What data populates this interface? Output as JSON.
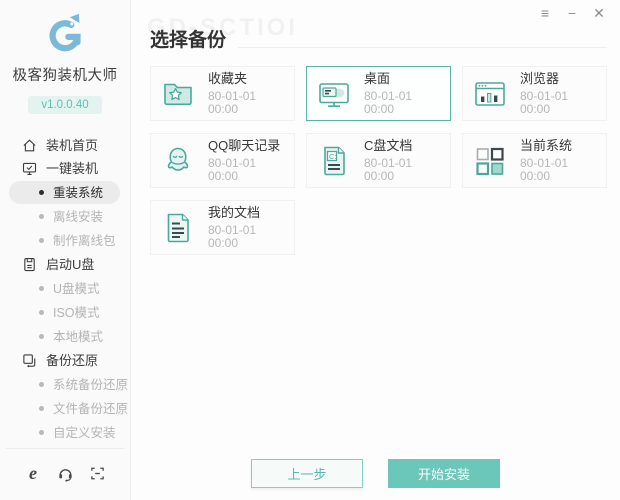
{
  "window": {
    "controls": {
      "menu": "≡",
      "minimize": "−",
      "close": "✕"
    }
  },
  "sidebar": {
    "app_name": "极客狗装机大师",
    "version": "v1.0.0.40",
    "menu": [
      {
        "label": "装机首页",
        "icon": "home-icon",
        "level": "top"
      },
      {
        "label": "一键装机",
        "icon": "monitor-icon",
        "level": "top"
      },
      {
        "label": "重装系统",
        "level": "sub",
        "active": true
      },
      {
        "label": "离线安装",
        "level": "sub",
        "active": false
      },
      {
        "label": "制作离线包",
        "level": "sub",
        "active": false
      },
      {
        "label": "启动U盘",
        "icon": "usb-disk-icon",
        "level": "top"
      },
      {
        "label": "U盘模式",
        "level": "sub",
        "active": false
      },
      {
        "label": "ISO模式",
        "level": "sub",
        "active": false
      },
      {
        "label": "本地模式",
        "level": "sub",
        "active": false
      },
      {
        "label": "备份还原",
        "icon": "backup-restore-icon",
        "level": "top"
      },
      {
        "label": "系统备份还原",
        "level": "sub",
        "active": false
      },
      {
        "label": "文件备份还原",
        "level": "sub",
        "active": false
      },
      {
        "label": "自定义安装",
        "level": "sub",
        "active": false
      }
    ],
    "footer_icons": [
      "browser-e-icon",
      "headset-icon",
      "scan-icon"
    ]
  },
  "main": {
    "title": "选择备份",
    "watermark": "GD-SCTIOI",
    "cards": [
      {
        "label": "收藏夹",
        "date": "80-01-01 00:00",
        "icon": "folder-star-icon",
        "selected": false
      },
      {
        "label": "桌面",
        "date": "80-01-01 00:00",
        "icon": "desktop-icon",
        "selected": true
      },
      {
        "label": "浏览器",
        "date": "80-01-01 00:00",
        "icon": "browser-icon",
        "selected": false
      },
      {
        "label": "QQ聊天记录",
        "date": "80-01-01 00:00",
        "icon": "qq-penguin-icon",
        "selected": false
      },
      {
        "label": "C盘文档",
        "date": "80-01-01 00:00",
        "icon": "c-drive-doc-icon",
        "selected": false
      },
      {
        "label": "当前系统",
        "date": "80-01-01 00:00",
        "icon": "system-grid-icon",
        "selected": false
      },
      {
        "label": "我的文档",
        "date": "80-01-01 00:00",
        "icon": "my-doc-icon",
        "selected": false
      }
    ],
    "buttons": {
      "prev": "上一步",
      "start": "开始安装"
    }
  },
  "colors": {
    "accent": "#6cc7bb",
    "accent_dark": "#4da89c",
    "accent_light_fill": "#cfeae4",
    "selected_border": "#58b3a9",
    "date_gray": "#b7b7b7",
    "inactive_menu": "#b4b4b4",
    "logo_blue": "#7cb8d8"
  }
}
